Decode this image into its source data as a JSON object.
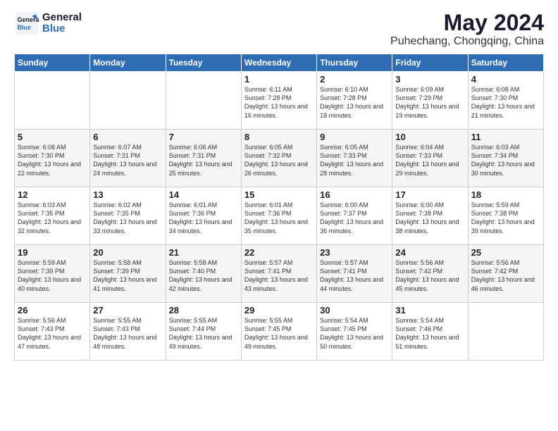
{
  "logo": {
    "line1": "General",
    "line2": "Blue"
  },
  "header": {
    "month": "May 2024",
    "location": "Puhechang, Chongqing, China"
  },
  "weekdays": [
    "Sunday",
    "Monday",
    "Tuesday",
    "Wednesday",
    "Thursday",
    "Friday",
    "Saturday"
  ],
  "weeks": [
    [
      {
        "day": "",
        "sunrise": "",
        "sunset": "",
        "daylight": ""
      },
      {
        "day": "",
        "sunrise": "",
        "sunset": "",
        "daylight": ""
      },
      {
        "day": "",
        "sunrise": "",
        "sunset": "",
        "daylight": ""
      },
      {
        "day": "1",
        "sunrise": "Sunrise: 6:11 AM",
        "sunset": "Sunset: 7:28 PM",
        "daylight": "Daylight: 13 hours and 16 minutes."
      },
      {
        "day": "2",
        "sunrise": "Sunrise: 6:10 AM",
        "sunset": "Sunset: 7:28 PM",
        "daylight": "Daylight: 13 hours and 18 minutes."
      },
      {
        "day": "3",
        "sunrise": "Sunrise: 6:09 AM",
        "sunset": "Sunset: 7:29 PM",
        "daylight": "Daylight: 13 hours and 19 minutes."
      },
      {
        "day": "4",
        "sunrise": "Sunrise: 6:08 AM",
        "sunset": "Sunset: 7:30 PM",
        "daylight": "Daylight: 13 hours and 21 minutes."
      }
    ],
    [
      {
        "day": "5",
        "sunrise": "Sunrise: 6:08 AM",
        "sunset": "Sunset: 7:30 PM",
        "daylight": "Daylight: 13 hours and 22 minutes."
      },
      {
        "day": "6",
        "sunrise": "Sunrise: 6:07 AM",
        "sunset": "Sunset: 7:31 PM",
        "daylight": "Daylight: 13 hours and 24 minutes."
      },
      {
        "day": "7",
        "sunrise": "Sunrise: 6:06 AM",
        "sunset": "Sunset: 7:31 PM",
        "daylight": "Daylight: 13 hours and 25 minutes."
      },
      {
        "day": "8",
        "sunrise": "Sunrise: 6:05 AM",
        "sunset": "Sunset: 7:32 PM",
        "daylight": "Daylight: 13 hours and 26 minutes."
      },
      {
        "day": "9",
        "sunrise": "Sunrise: 6:05 AM",
        "sunset": "Sunset: 7:33 PM",
        "daylight": "Daylight: 13 hours and 28 minutes."
      },
      {
        "day": "10",
        "sunrise": "Sunrise: 6:04 AM",
        "sunset": "Sunset: 7:33 PM",
        "daylight": "Daylight: 13 hours and 29 minutes."
      },
      {
        "day": "11",
        "sunrise": "Sunrise: 6:03 AM",
        "sunset": "Sunset: 7:34 PM",
        "daylight": "Daylight: 13 hours and 30 minutes."
      }
    ],
    [
      {
        "day": "12",
        "sunrise": "Sunrise: 6:03 AM",
        "sunset": "Sunset: 7:35 PM",
        "daylight": "Daylight: 13 hours and 32 minutes."
      },
      {
        "day": "13",
        "sunrise": "Sunrise: 6:02 AM",
        "sunset": "Sunset: 7:35 PM",
        "daylight": "Daylight: 13 hours and 33 minutes."
      },
      {
        "day": "14",
        "sunrise": "Sunrise: 6:01 AM",
        "sunset": "Sunset: 7:36 PM",
        "daylight": "Daylight: 13 hours and 34 minutes."
      },
      {
        "day": "15",
        "sunrise": "Sunrise: 6:01 AM",
        "sunset": "Sunset: 7:36 PM",
        "daylight": "Daylight: 13 hours and 35 minutes."
      },
      {
        "day": "16",
        "sunrise": "Sunrise: 6:00 AM",
        "sunset": "Sunset: 7:37 PM",
        "daylight": "Daylight: 13 hours and 36 minutes."
      },
      {
        "day": "17",
        "sunrise": "Sunrise: 6:00 AM",
        "sunset": "Sunset: 7:38 PM",
        "daylight": "Daylight: 13 hours and 38 minutes."
      },
      {
        "day": "18",
        "sunrise": "Sunrise: 5:59 AM",
        "sunset": "Sunset: 7:38 PM",
        "daylight": "Daylight: 13 hours and 39 minutes."
      }
    ],
    [
      {
        "day": "19",
        "sunrise": "Sunrise: 5:59 AM",
        "sunset": "Sunset: 7:39 PM",
        "daylight": "Daylight: 13 hours and 40 minutes."
      },
      {
        "day": "20",
        "sunrise": "Sunrise: 5:58 AM",
        "sunset": "Sunset: 7:39 PM",
        "daylight": "Daylight: 13 hours and 41 minutes."
      },
      {
        "day": "21",
        "sunrise": "Sunrise: 5:58 AM",
        "sunset": "Sunset: 7:40 PM",
        "daylight": "Daylight: 13 hours and 42 minutes."
      },
      {
        "day": "22",
        "sunrise": "Sunrise: 5:57 AM",
        "sunset": "Sunset: 7:41 PM",
        "daylight": "Daylight: 13 hours and 43 minutes."
      },
      {
        "day": "23",
        "sunrise": "Sunrise: 5:57 AM",
        "sunset": "Sunset: 7:41 PM",
        "daylight": "Daylight: 13 hours and 44 minutes."
      },
      {
        "day": "24",
        "sunrise": "Sunrise: 5:56 AM",
        "sunset": "Sunset: 7:42 PM",
        "daylight": "Daylight: 13 hours and 45 minutes."
      },
      {
        "day": "25",
        "sunrise": "Sunrise: 5:56 AM",
        "sunset": "Sunset: 7:42 PM",
        "daylight": "Daylight: 13 hours and 46 minutes."
      }
    ],
    [
      {
        "day": "26",
        "sunrise": "Sunrise: 5:56 AM",
        "sunset": "Sunset: 7:43 PM",
        "daylight": "Daylight: 13 hours and 47 minutes."
      },
      {
        "day": "27",
        "sunrise": "Sunrise: 5:55 AM",
        "sunset": "Sunset: 7:43 PM",
        "daylight": "Daylight: 13 hours and 48 minutes."
      },
      {
        "day": "28",
        "sunrise": "Sunrise: 5:55 AM",
        "sunset": "Sunset: 7:44 PM",
        "daylight": "Daylight: 13 hours and 49 minutes."
      },
      {
        "day": "29",
        "sunrise": "Sunrise: 5:55 AM",
        "sunset": "Sunset: 7:45 PM",
        "daylight": "Daylight: 13 hours and 49 minutes."
      },
      {
        "day": "30",
        "sunrise": "Sunrise: 5:54 AM",
        "sunset": "Sunset: 7:45 PM",
        "daylight": "Daylight: 13 hours and 50 minutes."
      },
      {
        "day": "31",
        "sunrise": "Sunrise: 5:54 AM",
        "sunset": "Sunset: 7:46 PM",
        "daylight": "Daylight: 13 hours and 51 minutes."
      },
      {
        "day": "",
        "sunrise": "",
        "sunset": "",
        "daylight": ""
      }
    ]
  ]
}
